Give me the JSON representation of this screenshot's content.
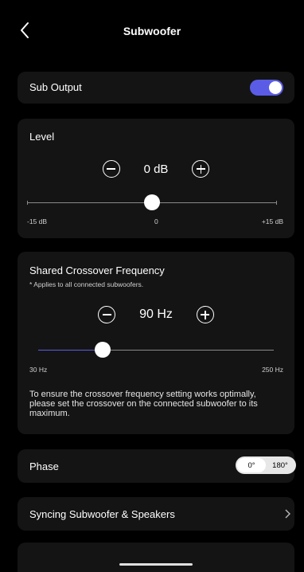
{
  "header": {
    "title": "Subwoofer"
  },
  "sub_output": {
    "label": "Sub Output",
    "enabled": true
  },
  "level": {
    "label": "Level",
    "value_text": "0 dB",
    "min_label": "-15 dB",
    "mid_label": "0",
    "max_label": "+15 dB",
    "value": 0
  },
  "crossover": {
    "title": "Shared Crossover Frequency",
    "note": "* Applies to all connected subwoofers.",
    "value_text": "90 Hz",
    "min_label": "30 Hz",
    "max_label": "250 Hz",
    "value": 90,
    "desc": "To ensure the crossover frequency setting works optimally, please set the crossover on the connected subwoofer to its maximum."
  },
  "phase": {
    "label": "Phase",
    "options": [
      "0°",
      "180°"
    ],
    "selected": "0°"
  },
  "sync": {
    "label": "Syncing Subwoofer & Speakers"
  },
  "colors": {
    "accent": "#5b5ce6",
    "background": "#000000",
    "card": "#141414"
  }
}
